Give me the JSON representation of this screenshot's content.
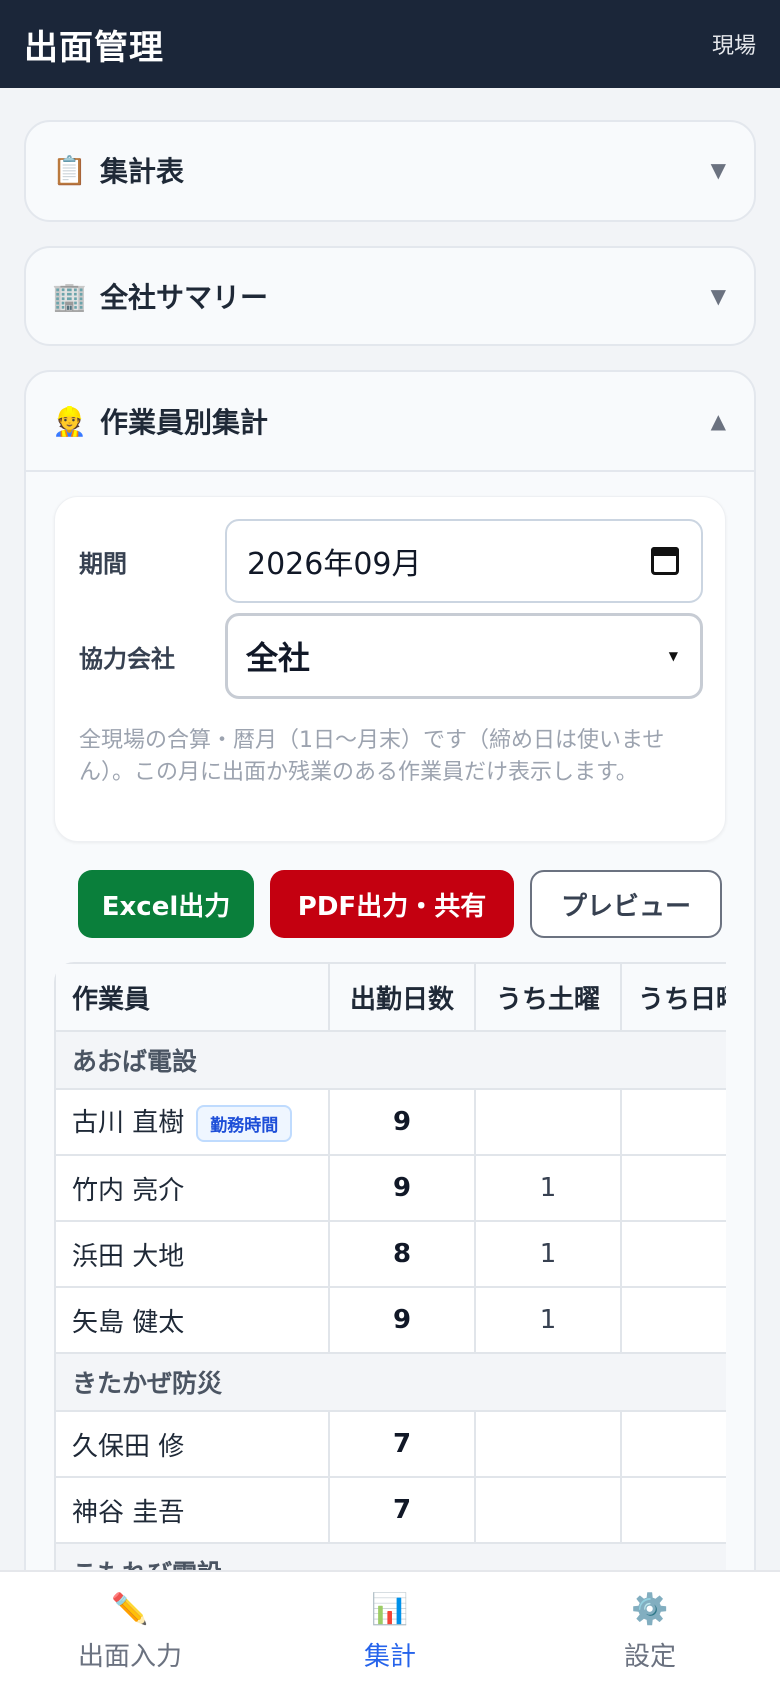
{
  "header": {
    "title": "出面管理",
    "link": "現場"
  },
  "sections": {
    "summary_table": {
      "icon": "📋",
      "title": "集計表",
      "chevron": "▼"
    },
    "company_summary": {
      "icon": "🏢",
      "title": "全社サマリー",
      "chevron": "▼"
    },
    "worker_summary": {
      "icon": "👷",
      "title": "作業員別集計",
      "chevron": "▲"
    }
  },
  "filters": {
    "period_label": "期間",
    "period_value": "2026年09月",
    "company_label": "協力会社",
    "company_value": "全社",
    "note": "全現場の合算・暦月（1日〜月末）です（締め日は使いません）。この月に出面か残業のある作業員だけ表示します。"
  },
  "buttons": {
    "excel": "Excel出力",
    "pdf": "PDF出力・共有",
    "preview": "プレビュー"
  },
  "table": {
    "headers": [
      "作業員",
      "出勤日数",
      "うち土曜",
      "うち日曜"
    ],
    "groups": [
      {
        "name": "あおば電設",
        "rows": [
          {
            "name": "古川 直樹",
            "badge": "勤務時間",
            "days": "9",
            "sat": "",
            "sun": ""
          },
          {
            "name": "竹内 亮介",
            "badge": "",
            "days": "9",
            "sat": "1",
            "sun": ""
          },
          {
            "name": "浜田 大地",
            "badge": "",
            "days": "8",
            "sat": "1",
            "sun": ""
          },
          {
            "name": "矢島 健太",
            "badge": "",
            "days": "9",
            "sat": "1",
            "sun": ""
          }
        ]
      },
      {
        "name": "きたかぜ防災",
        "rows": [
          {
            "name": "久保田 修",
            "badge": "",
            "days": "7",
            "sat": "",
            "sun": ""
          },
          {
            "name": "神谷 圭吾",
            "badge": "",
            "days": "7",
            "sat": "",
            "sun": ""
          }
        ]
      },
      {
        "name": "こもれび電設",
        "rows": []
      }
    ]
  },
  "nav": [
    {
      "icon": "✏️",
      "label": "出面入力",
      "active": false
    },
    {
      "icon": "📊",
      "label": "集計",
      "active": true
    },
    {
      "icon": "⚙️",
      "label": "設定",
      "active": false
    }
  ],
  "colors": {
    "header_bg": "#1b2639",
    "excel": "#0a7f3b",
    "pdf": "#c40010",
    "active_nav": "#2563eb"
  }
}
